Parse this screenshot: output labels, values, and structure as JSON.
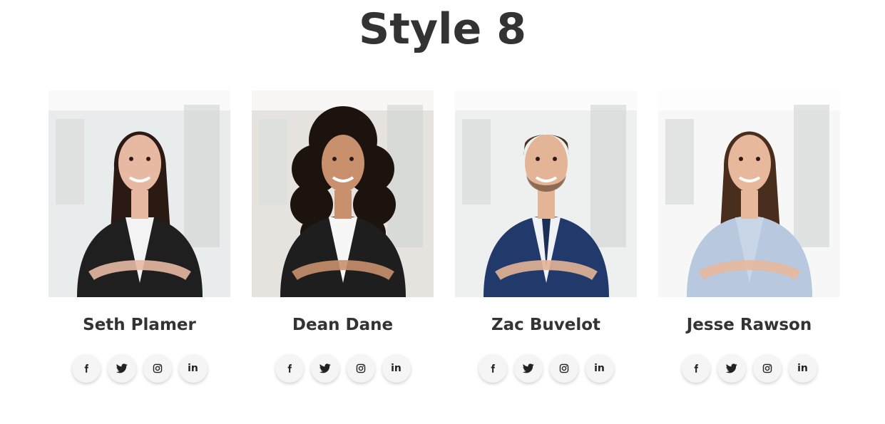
{
  "title": "Style 8",
  "members": [
    {
      "name": "Seth Plamer",
      "photo": {
        "bg": "#e9ecec",
        "hair": "#2b1a14",
        "skin": "#e7b9a3",
        "top": "#1f1f1f",
        "shirt": "#f3f3f3",
        "hair_style": "long"
      }
    },
    {
      "name": "Dean Dane",
      "photo": {
        "bg": "#e6e3de",
        "hair": "#1c130f",
        "skin": "#c8906c",
        "top": "#1e1e1e",
        "shirt": "#f7f7f7",
        "hair_style": "curly"
      }
    },
    {
      "name": "Zac Buvelot",
      "photo": {
        "bg": "#eef0ef",
        "hair": "#4a3022",
        "skin": "#e3b496",
        "top": "#213a6b",
        "shirt": "#f0f3f6",
        "hair_style": "short"
      }
    },
    {
      "name": "Jesse Rawson",
      "photo": {
        "bg": "#f6f7f6",
        "hair": "#4a2e1d",
        "skin": "#e8b89d",
        "top": "#b7c8df",
        "shirt": "#c9d6e8",
        "hair_style": "long"
      }
    }
  ],
  "social_icons": [
    "facebook-icon",
    "twitter-icon",
    "instagram-icon",
    "linkedin-icon"
  ],
  "social_labels": {
    "linkedin": "in"
  },
  "colors": {
    "text": "#333333",
    "icon_bg": "#f5f5f5",
    "icon_fg": "#222222"
  }
}
